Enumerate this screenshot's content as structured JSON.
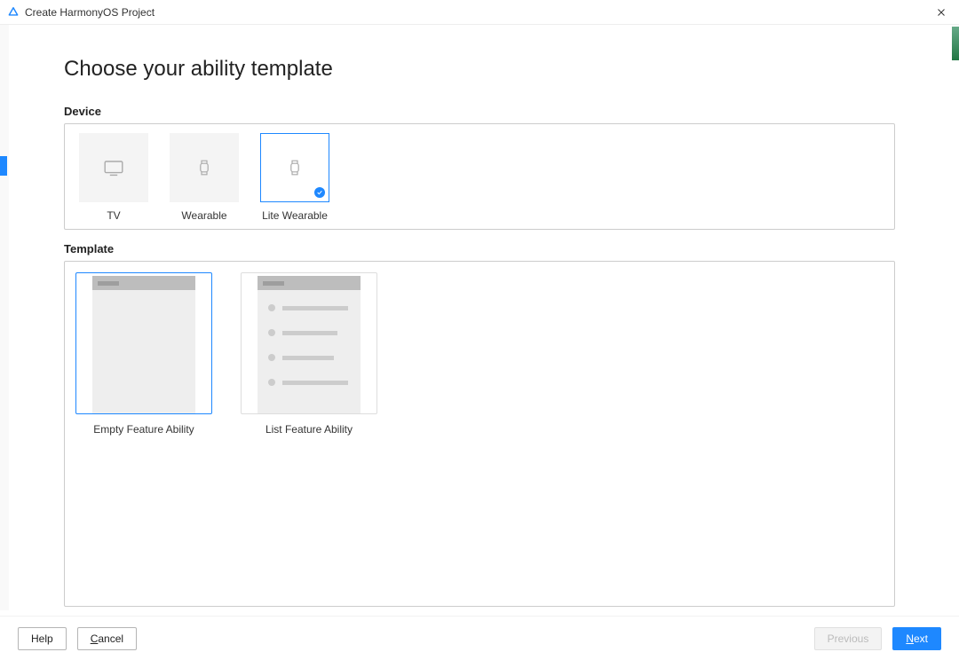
{
  "window": {
    "title": "Create HarmonyOS Project"
  },
  "heading": "Choose your ability template",
  "sections": {
    "device_label": "Device",
    "template_label": "Template"
  },
  "devices": [
    {
      "id": "tv",
      "label": "TV",
      "selected": false
    },
    {
      "id": "wearable",
      "label": "Wearable",
      "selected": false
    },
    {
      "id": "lite-wearable",
      "label": "Lite Wearable",
      "selected": true
    }
  ],
  "templates": [
    {
      "id": "empty-feature",
      "label": "Empty Feature Ability",
      "kind": "empty",
      "selected": true
    },
    {
      "id": "list-feature",
      "label": "List Feature Ability",
      "kind": "list",
      "selected": false
    }
  ],
  "footer": {
    "help": "Help",
    "cancel": "Cancel",
    "previous": "Previous",
    "next": "Next"
  }
}
